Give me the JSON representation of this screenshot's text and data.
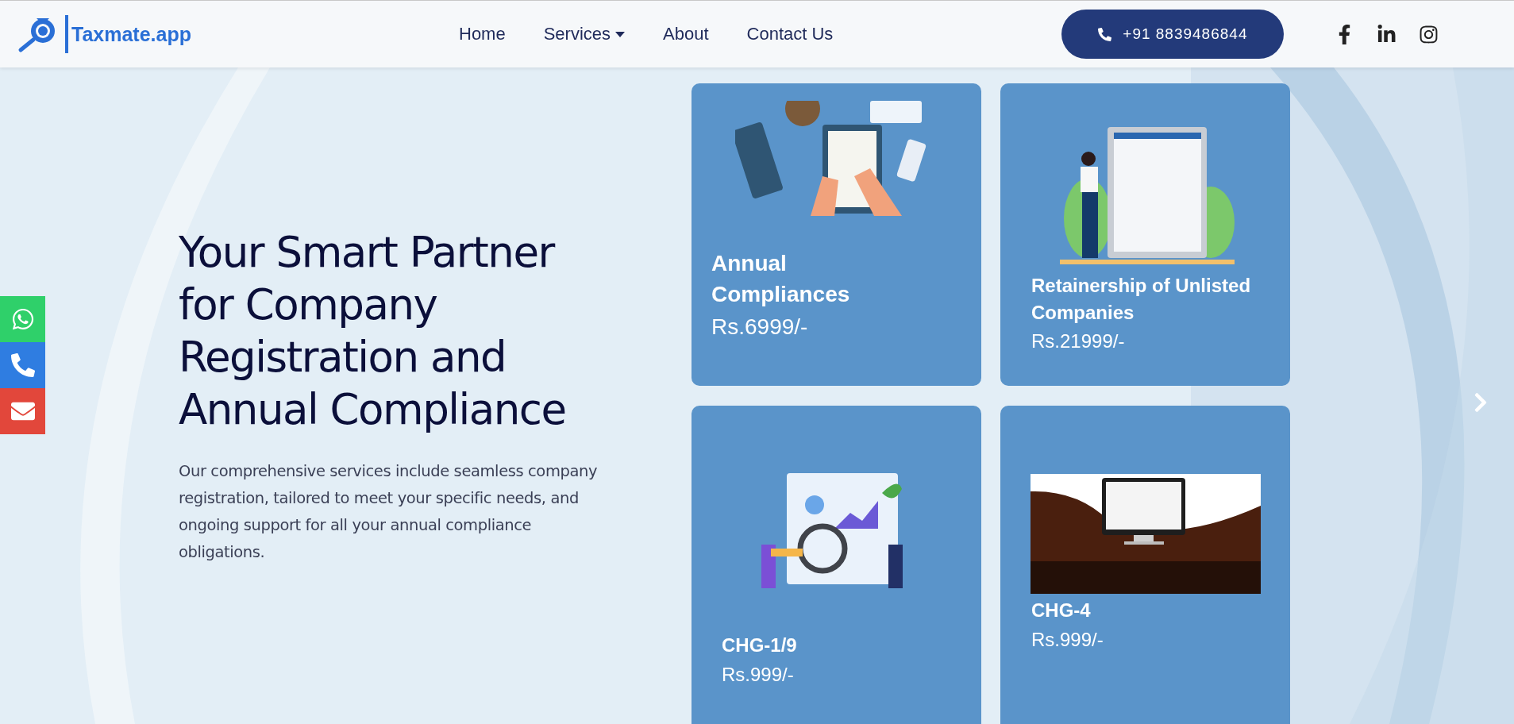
{
  "header": {
    "logo": "Taxmate.app",
    "nav": [
      {
        "label": "Home",
        "dropdown": false
      },
      {
        "label": "Services",
        "dropdown": true
      },
      {
        "label": "About",
        "dropdown": false
      },
      {
        "label": "Contact Us",
        "dropdown": false
      }
    ],
    "phone": "+91 8839486844",
    "social": [
      {
        "kind": "facebook"
      },
      {
        "kind": "linkedin"
      },
      {
        "kind": "instagram"
      }
    ]
  },
  "hero": {
    "title": "Your Smart Partner for Company Registration and Annual Compliance",
    "description": "Our comprehensive services include seamless company registration, tailored to meet your specific needs, and ongoing support for all your annual compliance obligations."
  },
  "cards": [
    {
      "kind": "checklist",
      "title": "Annual Compliances",
      "price": "Rs.6999/-"
    },
    {
      "kind": "registration",
      "title": "Retainership of Unlisted Companies",
      "price": "Rs.21999/-"
    },
    {
      "kind": "analytics",
      "title": "CHG-1/9",
      "price": "Rs.999/-"
    },
    {
      "kind": "banner",
      "title": "CHG-4",
      "price": "Rs.999/-"
    }
  ],
  "side_buttons": [
    {
      "kind": "whatsapp",
      "color": "#2fd06a"
    },
    {
      "kind": "phone",
      "color": "#2f7de1"
    },
    {
      "kind": "email",
      "color": "#e2473b"
    }
  ]
}
